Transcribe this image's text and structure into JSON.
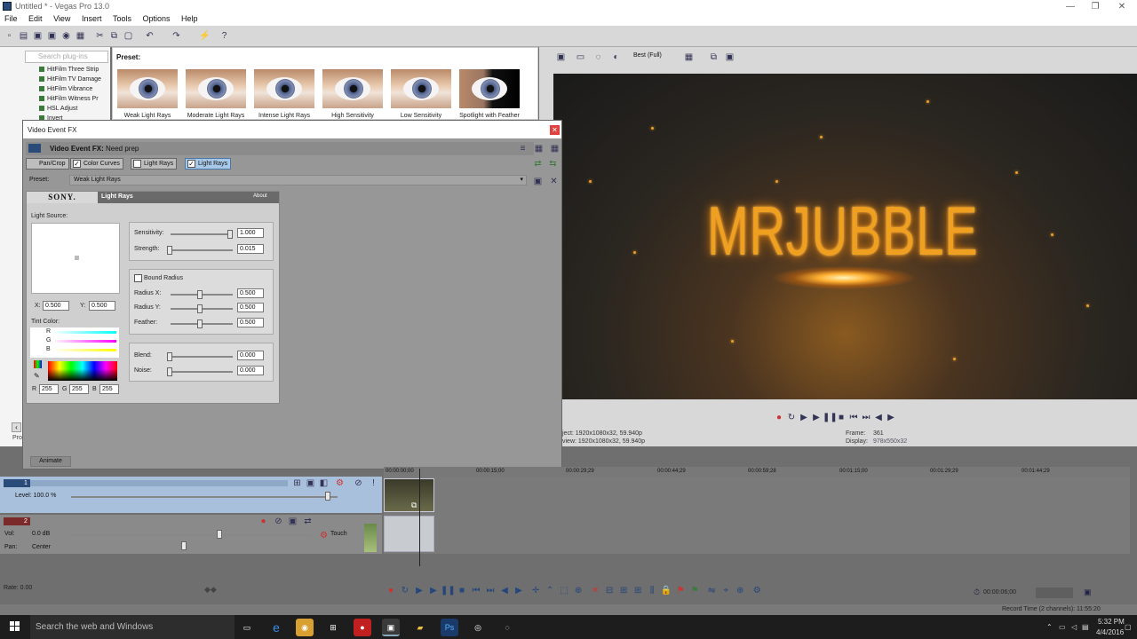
{
  "window": {
    "title": "Untitled * - Vegas Pro 13.0"
  },
  "menu": [
    "File",
    "Edit",
    "View",
    "Insert",
    "Tools",
    "Options",
    "Help"
  ],
  "explorer": {
    "search_placeholder": "Search plug-ins",
    "items": [
      "HitFilm Three Strip",
      "HitFilm TV Damage",
      "HitFilm Vibrance",
      "HitFilm Witness Pr",
      "HSL Adjust",
      "Invert"
    ]
  },
  "presets": {
    "label": "Preset:",
    "items": [
      "Weak Light Rays",
      "Moderate Light Rays",
      "Intense Light Rays",
      "High Sensitivity",
      "Low Sensitivity",
      "Spotlight with Feather"
    ]
  },
  "preview_toolbar": {
    "quality": "Best (Full)"
  },
  "video": {
    "overlay_text": "MRJUBBLE"
  },
  "preview_info": {
    "project": "ject:  1920x1080x32, 59.940p",
    "preview": "view:  1920x1080x32, 59.940p",
    "frame_label": "Frame:",
    "frame_value": "361",
    "display_label": "Display:",
    "display_value": "978x550x32"
  },
  "dialog": {
    "title": "Video Event FX",
    "event_fx": "Video Event FX:",
    "event_name": "Need prep",
    "chain": [
      "Pan/Crop",
      "Color Curves",
      "Light Rays",
      "Light Rays"
    ],
    "preset_label": "Preset:",
    "preset_value": "Weak Light Rays",
    "plugin_brand": "SONY.",
    "plugin_name": "Light Rays",
    "about": "About",
    "light_source": "Light Source:",
    "x_label": "X:",
    "x_value": "0.500",
    "y_label": "Y:",
    "y_value": "0.500",
    "tint_color": "Tint Color:",
    "rgb_r": "R",
    "rgb_g": "G",
    "rgb_b": "B",
    "r_value": "255",
    "g_value": "255",
    "b_value": "255",
    "sensitivity_label": "Sensitivity:",
    "sensitivity_value": "1.000",
    "strength_label": "Strength:",
    "strength_value": "0.015",
    "bound_radius": "Bound Radius",
    "radius_x_label": "Radius X:",
    "radius_x_value": "0.500",
    "radius_y_label": "Radius Y:",
    "radius_y_value": "0.500",
    "feather_label": "Feather:",
    "feather_value": "0.500",
    "blend_label": "Blend:",
    "blend_value": "0.000",
    "noise_label": "Noise:",
    "noise_value": "0.000",
    "animate": "Animate"
  },
  "timeline": {
    "ruler": [
      "00:00:00;00",
      "00:00:15;00",
      "00:00:29;29",
      "00:00:44;29",
      "00:00:59;28",
      "00:01:15;00",
      "00:01:29;29",
      "00:01:44;29"
    ],
    "track1": {
      "number": "1",
      "level": "Level: 100.0 %"
    },
    "track2": {
      "number": "2",
      "vol_label": "Vol:",
      "vol_value": "0.0 dB",
      "pan_label": "Pan:",
      "pan_value": "Center",
      "touch": "Touch"
    },
    "rate": "Rate: 0.00",
    "timecode": "00:00:06;00",
    "record_time": "Record Time (2 channels): 11:55:20",
    "left_tab": "Pro"
  },
  "taskbar": {
    "search": "Search the web and Windows",
    "time": "5:32 PM",
    "date": "4/4/2016"
  }
}
